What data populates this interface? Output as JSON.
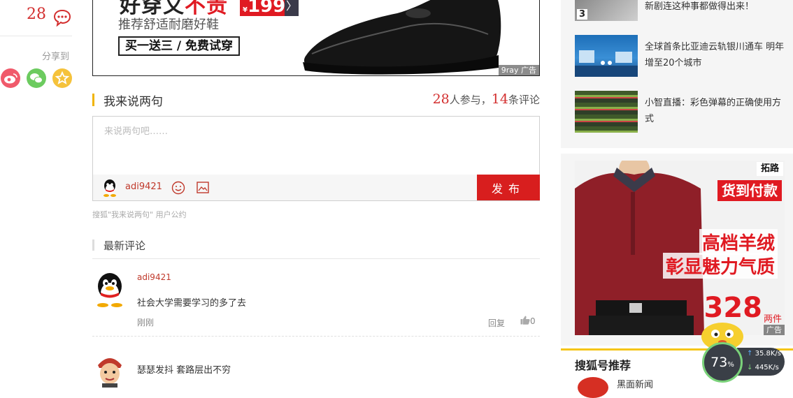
{
  "left_rail": {
    "comment_count": "28",
    "share_label": "分享到"
  },
  "ad_banner": {
    "title_black": "好穿又",
    "title_red": "不贵",
    "price_symbol": "¥",
    "price": "199",
    "arrow": "〉",
    "subtitle": "推荐舒适耐磨好鞋",
    "promo": "买一送三 / 免费试穿",
    "tag": "广告",
    "partner": "9ray"
  },
  "comment_section": {
    "title": "我来说两句",
    "participants": "28",
    "participants_label": "人参与，",
    "comments": "14",
    "comments_label": "条评论",
    "input_placeholder": "来说两句吧……",
    "username": "adi9421",
    "publish_label": "发布",
    "agreement": "搜狐\"我来说两句\" 用户公约"
  },
  "latest_comments": {
    "title": "最新评论",
    "items": [
      {
        "user": "adi9421",
        "text": "社会大学需要学习的多了去",
        "time": "刚刚",
        "reply_label": "回复",
        "likes": "0"
      },
      {
        "text": "瑟瑟发抖 套路层出不穷"
      }
    ]
  },
  "sidebar": {
    "news": [
      {
        "text": "新剧连这种事都做得出来！",
        "thumb_badge": "3"
      },
      {
        "text": "全球首条比亚迪云轨银川通车 明年增至20个城市"
      },
      {
        "text": "小智直播：彩色弹幕的正确使用方式"
      }
    ],
    "ad": {
      "brand": "拓路",
      "cod": "货到付款",
      "line1": "高档羊绒",
      "line2": "彰显魅力气质",
      "price": "328",
      "unit": "两件",
      "tag": "广告"
    },
    "sohu_title": "搜狐号推荐",
    "sohu_next": "黑面新闻"
  },
  "speed_widget": {
    "percent": "73",
    "percent_sign": "%",
    "upload": "35.8",
    "download": "445",
    "unit": "K/s"
  },
  "colors": {
    "accent_red": "#d81e1e",
    "section_bar": "#f0b400",
    "sohu_yellow": "#f5c518"
  }
}
